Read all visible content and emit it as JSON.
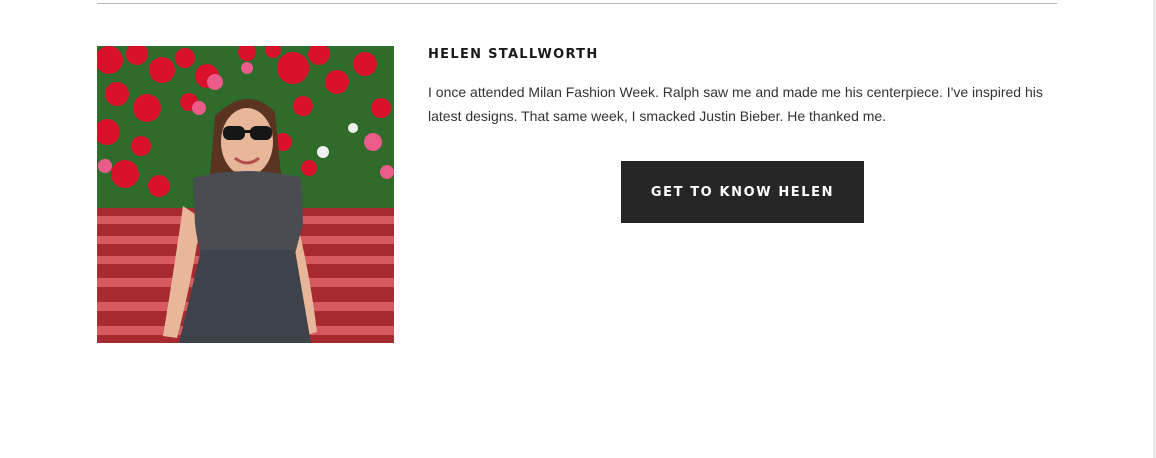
{
  "profile": {
    "name": "HELEN STALLWORTH",
    "bio": "I once attended Milan Fashion Week. Ralph saw me and made me his centerpiece. I've inspired his latest designs. That same week, I smacked Justin Bieber. He thanked me.",
    "photo_icon": "photo-woman-on-bench-icon"
  },
  "cta": {
    "label": "GET TO KNOW HELEN",
    "background": "#262626",
    "text_color": "#ffffff"
  }
}
